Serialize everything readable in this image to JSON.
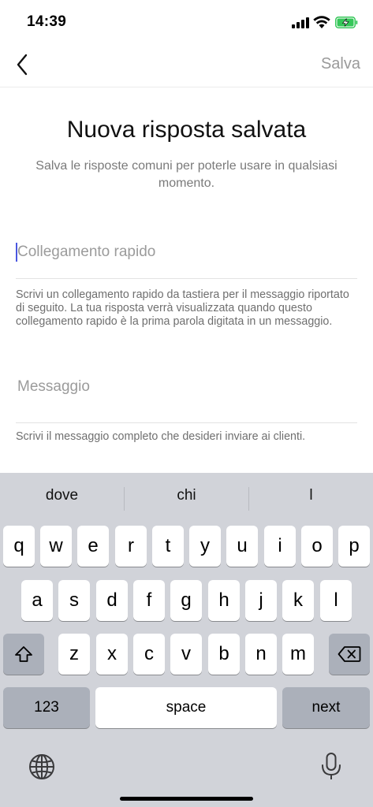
{
  "status_bar": {
    "time": "14:39"
  },
  "nav": {
    "save_label": "Salva"
  },
  "header": {
    "title": "Nuova risposta salvata",
    "subtitle": "Salva le risposte comuni per poterle usare in qualsiasi momento."
  },
  "shortcut_field": {
    "placeholder": "Collegamento rapido",
    "helper": "Scrivi un collegamento rapido da tastiera per il messaggio riportato di seguito. La tua risposta verrà visualizzata quando questo collegamento rapido è la prima parola digitata in un messaggio."
  },
  "message_field": {
    "placeholder": "Messaggio",
    "helper": "Scrivi il messaggio completo che desideri inviare ai clienti."
  },
  "keyboard": {
    "suggestions": [
      "dove",
      "chi",
      "l"
    ],
    "row1": [
      "q",
      "w",
      "e",
      "r",
      "t",
      "y",
      "u",
      "i",
      "o",
      "p"
    ],
    "row2": [
      "a",
      "s",
      "d",
      "f",
      "g",
      "h",
      "j",
      "k",
      "l"
    ],
    "row3": [
      "z",
      "x",
      "c",
      "v",
      "b",
      "n",
      "m"
    ],
    "numbers_label": "123",
    "space_label": "space",
    "next_label": "next"
  },
  "colors": {
    "accent_cursor": "#4a57e0",
    "keyboard_bg": "#d1d3d9",
    "key_dark": "#abb0ba",
    "battery_green": "#35c759"
  },
  "icons": {
    "back": "chevron-left-icon",
    "shift": "shift-icon",
    "delete": "backspace-icon",
    "globe": "globe-icon",
    "mic": "microphone-icon"
  }
}
